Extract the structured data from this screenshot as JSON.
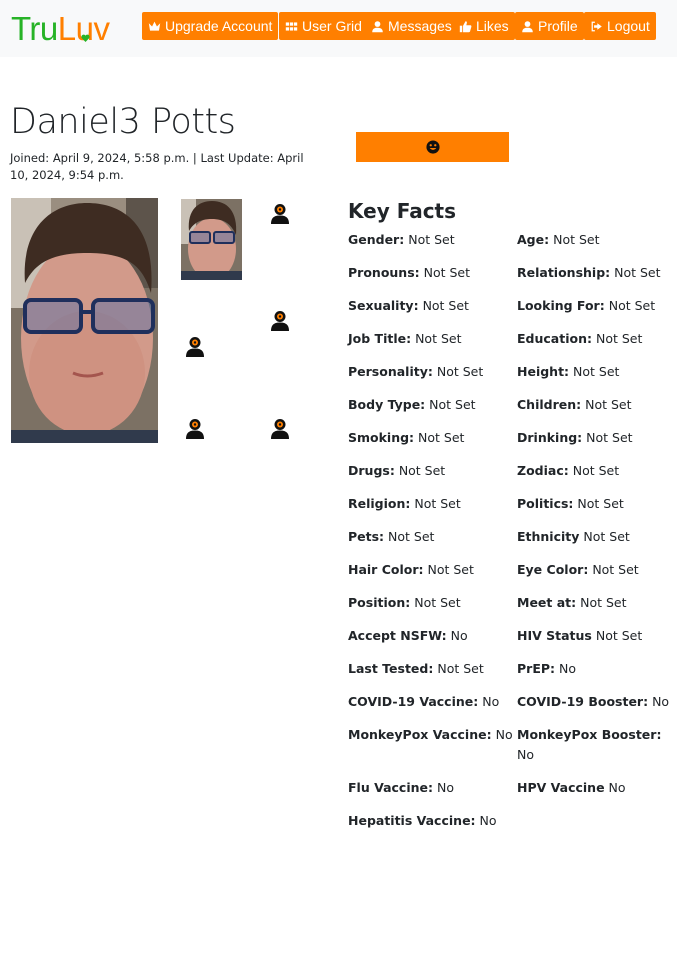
{
  "brand": {
    "logo_part1": "Tru",
    "logo_part2": "Luv"
  },
  "nav": [
    {
      "label": "Upgrade Account",
      "icon": "crown-icon"
    },
    {
      "label": "User Grid",
      "icon": "grid-icon"
    },
    {
      "label": "Messages",
      "icon": "user-icon"
    },
    {
      "label": "Likes",
      "icon": "thumbs-up-icon"
    },
    {
      "label": "Profile",
      "icon": "user-icon"
    },
    {
      "label": "Logout",
      "icon": "logout-icon"
    }
  ],
  "profile": {
    "name": "Daniel3 Potts",
    "joined": "Joined: April 9, 2024, 5:58 p.m. | Last Update: April 10, 2024, 9:54 p.m.",
    "emoji_button_icon": "smile-icon"
  },
  "key_facts": {
    "title": "Key Facts",
    "items": [
      {
        "label": "Gender:",
        "value": "Not Set"
      },
      {
        "label": "Age:",
        "value": "Not Set"
      },
      {
        "label": "Pronouns:",
        "value": "Not Set"
      },
      {
        "label": "Relationship:",
        "value": "Not Set"
      },
      {
        "label": "Sexuality:",
        "value": "Not Set"
      },
      {
        "label": "Looking For:",
        "value": "Not Set"
      },
      {
        "label": "Job Title:",
        "value": "Not Set"
      },
      {
        "label": "Education:",
        "value": "Not Set"
      },
      {
        "label": "Personality:",
        "value": "Not Set"
      },
      {
        "label": "Height:",
        "value": "Not Set"
      },
      {
        "label": "Body Type:",
        "value": "Not Set"
      },
      {
        "label": "Children:",
        "value": "Not Set"
      },
      {
        "label": "Smoking:",
        "value": "Not Set"
      },
      {
        "label": "Drinking:",
        "value": "Not Set"
      },
      {
        "label": "Drugs:",
        "value": "Not Set"
      },
      {
        "label": "Zodiac:",
        "value": "Not Set"
      },
      {
        "label": "Religion:",
        "value": "Not Set"
      },
      {
        "label": "Politics:",
        "value": "Not Set"
      },
      {
        "label": "Pets:",
        "value": "Not Set"
      },
      {
        "label": "Ethnicity",
        "value": "Not Set"
      },
      {
        "label": "Hair Color:",
        "value": "Not Set"
      },
      {
        "label": "Eye Color:",
        "value": "Not Set"
      },
      {
        "label": "Position:",
        "value": "Not Set"
      },
      {
        "label": "Meet at:",
        "value": "Not Set"
      },
      {
        "label": "Accept NSFW:",
        "value": "No"
      },
      {
        "label": "HIV Status",
        "value": "Not Set"
      },
      {
        "label": "Last Tested:",
        "value": "Not Set"
      },
      {
        "label": "PrEP:",
        "value": "No"
      },
      {
        "label": "COVID-19 Vaccine:",
        "value": "No"
      },
      {
        "label": "COVID-19 Booster:",
        "value": "No"
      },
      {
        "label": "MonkeyPox Vaccine:",
        "value": "No"
      },
      {
        "label": "MonkeyPox Booster:",
        "value": "No"
      },
      {
        "label": "Flu Vaccine:",
        "value": "No"
      },
      {
        "label": "HPV Vaccine",
        "value": "No"
      },
      {
        "label": "Hepatitis Vaccine:",
        "value": "No"
      }
    ]
  },
  "colors": {
    "accent": "#ff7f00",
    "brand_green": "#27b327",
    "nav_bg": "#f8f9fa"
  }
}
